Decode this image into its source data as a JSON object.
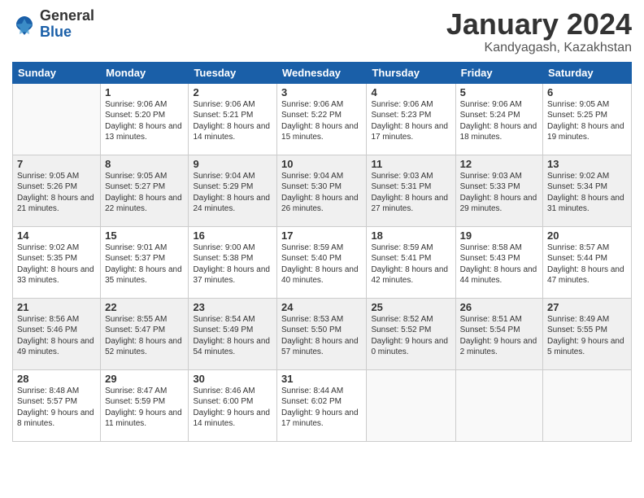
{
  "logo": {
    "general": "General",
    "blue": "Blue"
  },
  "title": "January 2024",
  "subtitle": "Kandyagash, Kazakhstan",
  "headers": [
    "Sunday",
    "Monday",
    "Tuesday",
    "Wednesday",
    "Thursday",
    "Friday",
    "Saturday"
  ],
  "weeks": [
    [
      {
        "day": "",
        "sunrise": "",
        "sunset": "",
        "daylight": ""
      },
      {
        "day": "1",
        "sunrise": "Sunrise: 9:06 AM",
        "sunset": "Sunset: 5:20 PM",
        "daylight": "Daylight: 8 hours and 13 minutes."
      },
      {
        "day": "2",
        "sunrise": "Sunrise: 9:06 AM",
        "sunset": "Sunset: 5:21 PM",
        "daylight": "Daylight: 8 hours and 14 minutes."
      },
      {
        "day": "3",
        "sunrise": "Sunrise: 9:06 AM",
        "sunset": "Sunset: 5:22 PM",
        "daylight": "Daylight: 8 hours and 15 minutes."
      },
      {
        "day": "4",
        "sunrise": "Sunrise: 9:06 AM",
        "sunset": "Sunset: 5:23 PM",
        "daylight": "Daylight: 8 hours and 17 minutes."
      },
      {
        "day": "5",
        "sunrise": "Sunrise: 9:06 AM",
        "sunset": "Sunset: 5:24 PM",
        "daylight": "Daylight: 8 hours and 18 minutes."
      },
      {
        "day": "6",
        "sunrise": "Sunrise: 9:05 AM",
        "sunset": "Sunset: 5:25 PM",
        "daylight": "Daylight: 8 hours and 19 minutes."
      }
    ],
    [
      {
        "day": "7",
        "sunrise": "Sunrise: 9:05 AM",
        "sunset": "Sunset: 5:26 PM",
        "daylight": "Daylight: 8 hours and 21 minutes."
      },
      {
        "day": "8",
        "sunrise": "Sunrise: 9:05 AM",
        "sunset": "Sunset: 5:27 PM",
        "daylight": "Daylight: 8 hours and 22 minutes."
      },
      {
        "day": "9",
        "sunrise": "Sunrise: 9:04 AM",
        "sunset": "Sunset: 5:29 PM",
        "daylight": "Daylight: 8 hours and 24 minutes."
      },
      {
        "day": "10",
        "sunrise": "Sunrise: 9:04 AM",
        "sunset": "Sunset: 5:30 PM",
        "daylight": "Daylight: 8 hours and 26 minutes."
      },
      {
        "day": "11",
        "sunrise": "Sunrise: 9:03 AM",
        "sunset": "Sunset: 5:31 PM",
        "daylight": "Daylight: 8 hours and 27 minutes."
      },
      {
        "day": "12",
        "sunrise": "Sunrise: 9:03 AM",
        "sunset": "Sunset: 5:33 PM",
        "daylight": "Daylight: 8 hours and 29 minutes."
      },
      {
        "day": "13",
        "sunrise": "Sunrise: 9:02 AM",
        "sunset": "Sunset: 5:34 PM",
        "daylight": "Daylight: 8 hours and 31 minutes."
      }
    ],
    [
      {
        "day": "14",
        "sunrise": "Sunrise: 9:02 AM",
        "sunset": "Sunset: 5:35 PM",
        "daylight": "Daylight: 8 hours and 33 minutes."
      },
      {
        "day": "15",
        "sunrise": "Sunrise: 9:01 AM",
        "sunset": "Sunset: 5:37 PM",
        "daylight": "Daylight: 8 hours and 35 minutes."
      },
      {
        "day": "16",
        "sunrise": "Sunrise: 9:00 AM",
        "sunset": "Sunset: 5:38 PM",
        "daylight": "Daylight: 8 hours and 37 minutes."
      },
      {
        "day": "17",
        "sunrise": "Sunrise: 8:59 AM",
        "sunset": "Sunset: 5:40 PM",
        "daylight": "Daylight: 8 hours and 40 minutes."
      },
      {
        "day": "18",
        "sunrise": "Sunrise: 8:59 AM",
        "sunset": "Sunset: 5:41 PM",
        "daylight": "Daylight: 8 hours and 42 minutes."
      },
      {
        "day": "19",
        "sunrise": "Sunrise: 8:58 AM",
        "sunset": "Sunset: 5:43 PM",
        "daylight": "Daylight: 8 hours and 44 minutes."
      },
      {
        "day": "20",
        "sunrise": "Sunrise: 8:57 AM",
        "sunset": "Sunset: 5:44 PM",
        "daylight": "Daylight: 8 hours and 47 minutes."
      }
    ],
    [
      {
        "day": "21",
        "sunrise": "Sunrise: 8:56 AM",
        "sunset": "Sunset: 5:46 PM",
        "daylight": "Daylight: 8 hours and 49 minutes."
      },
      {
        "day": "22",
        "sunrise": "Sunrise: 8:55 AM",
        "sunset": "Sunset: 5:47 PM",
        "daylight": "Daylight: 8 hours and 52 minutes."
      },
      {
        "day": "23",
        "sunrise": "Sunrise: 8:54 AM",
        "sunset": "Sunset: 5:49 PM",
        "daylight": "Daylight: 8 hours and 54 minutes."
      },
      {
        "day": "24",
        "sunrise": "Sunrise: 8:53 AM",
        "sunset": "Sunset: 5:50 PM",
        "daylight": "Daylight: 8 hours and 57 minutes."
      },
      {
        "day": "25",
        "sunrise": "Sunrise: 8:52 AM",
        "sunset": "Sunset: 5:52 PM",
        "daylight": "Daylight: 9 hours and 0 minutes."
      },
      {
        "day": "26",
        "sunrise": "Sunrise: 8:51 AM",
        "sunset": "Sunset: 5:54 PM",
        "daylight": "Daylight: 9 hours and 2 minutes."
      },
      {
        "day": "27",
        "sunrise": "Sunrise: 8:49 AM",
        "sunset": "Sunset: 5:55 PM",
        "daylight": "Daylight: 9 hours and 5 minutes."
      }
    ],
    [
      {
        "day": "28",
        "sunrise": "Sunrise: 8:48 AM",
        "sunset": "Sunset: 5:57 PM",
        "daylight": "Daylight: 9 hours and 8 minutes."
      },
      {
        "day": "29",
        "sunrise": "Sunrise: 8:47 AM",
        "sunset": "Sunset: 5:59 PM",
        "daylight": "Daylight: 9 hours and 11 minutes."
      },
      {
        "day": "30",
        "sunrise": "Sunrise: 8:46 AM",
        "sunset": "Sunset: 6:00 PM",
        "daylight": "Daylight: 9 hours and 14 minutes."
      },
      {
        "day": "31",
        "sunrise": "Sunrise: 8:44 AM",
        "sunset": "Sunset: 6:02 PM",
        "daylight": "Daylight: 9 hours and 17 minutes."
      },
      {
        "day": "",
        "sunrise": "",
        "sunset": "",
        "daylight": ""
      },
      {
        "day": "",
        "sunrise": "",
        "sunset": "",
        "daylight": ""
      },
      {
        "day": "",
        "sunrise": "",
        "sunset": "",
        "daylight": ""
      }
    ]
  ]
}
